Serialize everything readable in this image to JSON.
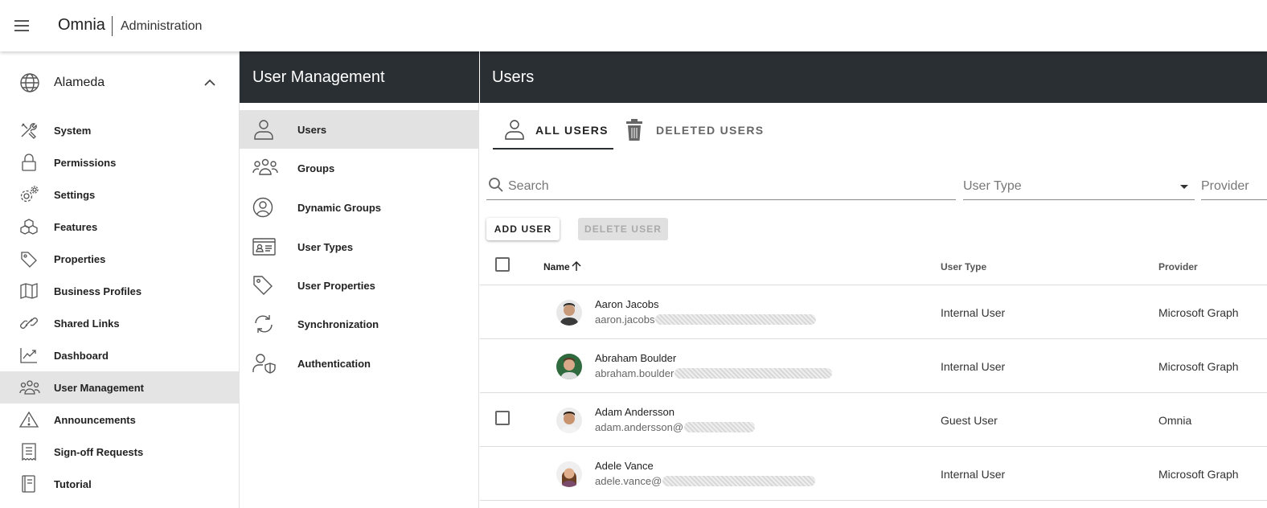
{
  "app": {
    "brand": "Omnia",
    "subtitle": "Administration"
  },
  "tenant": {
    "label": "Alameda"
  },
  "left_nav": {
    "items": [
      {
        "label": "System",
        "icon": "tools-icon"
      },
      {
        "label": "Permissions",
        "icon": "lock-icon"
      },
      {
        "label": "Settings",
        "icon": "gears-icon"
      },
      {
        "label": "Features",
        "icon": "cubes-icon"
      },
      {
        "label": "Properties",
        "icon": "tag-icon"
      },
      {
        "label": "Business Profiles",
        "icon": "map-icon"
      },
      {
        "label": "Shared Links",
        "icon": "link-icon"
      },
      {
        "label": "Dashboard",
        "icon": "chart-icon"
      },
      {
        "label": "User Management",
        "icon": "people-icon",
        "active": true
      },
      {
        "label": "Announcements",
        "icon": "warning-icon"
      },
      {
        "label": "Sign-off Requests",
        "icon": "receipt-icon"
      },
      {
        "label": "Tutorial",
        "icon": "book-icon"
      }
    ]
  },
  "mid_panel": {
    "title": "User Management",
    "items": [
      {
        "label": "Users",
        "icon": "user-icon",
        "active": true
      },
      {
        "label": "Groups",
        "icon": "group-icon"
      },
      {
        "label": "Dynamic Groups",
        "icon": "user-circle-icon"
      },
      {
        "label": "User Types",
        "icon": "id-card-icon"
      },
      {
        "label": "User Properties",
        "icon": "tag-icon"
      },
      {
        "label": "Synchronization",
        "icon": "sync-icon"
      },
      {
        "label": "Authentication",
        "icon": "user-shield-icon"
      }
    ]
  },
  "main": {
    "title": "Users",
    "tabs": {
      "all": "ALL USERS",
      "deleted": "DELETED USERS"
    },
    "filters": {
      "search_placeholder": "Search",
      "user_type_placeholder": "User Type",
      "provider_placeholder": "Provider"
    },
    "buttons": {
      "add": "ADD USER",
      "delete": "DELETE USER"
    },
    "table": {
      "columns": [
        "Name",
        "User Type",
        "Provider"
      ],
      "rows": [
        {
          "name": "Aaron Jacobs",
          "email": "aaron.jacobs",
          "user_type": "Internal User",
          "provider": "Microsoft Graph"
        },
        {
          "name": "Abraham Boulder",
          "email": "abraham.boulder",
          "user_type": "Internal User",
          "provider": "Microsoft Graph"
        },
        {
          "name": "Adam Andersson",
          "email": "adam.andersson@",
          "user_type": "Guest User",
          "provider": "Omnia"
        },
        {
          "name": "Adele Vance",
          "email": "adele.vance@",
          "user_type": "Internal User",
          "provider": "Microsoft Graph"
        }
      ]
    }
  }
}
